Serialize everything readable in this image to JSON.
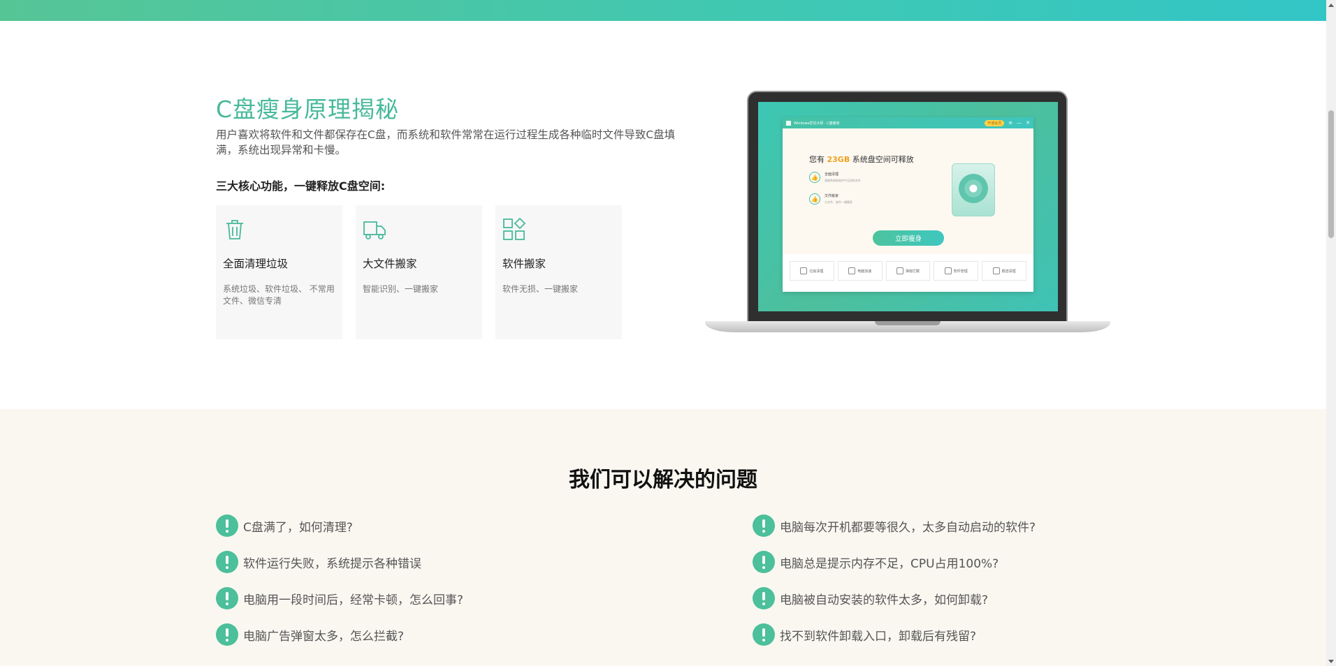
{
  "section_cleanup": {
    "title": "C盘瘦身原理揭秘",
    "description": "用户喜欢将软件和文件都保存在C盘，而系统和软件常常在运行过程生成各种临时文件导致C盘填满，系统出现异常和卡慢。",
    "subtitle": "三大核心功能，一键释放C盘空间:",
    "features": [
      {
        "icon": "trash-icon",
        "name": "全面清理垃圾",
        "desc": "系统垃圾、软件垃圾、 不常用文件、微信专清"
      },
      {
        "icon": "truck-icon",
        "name": "大文件搬家",
        "desc": "智能识别、一键搬家"
      },
      {
        "icon": "apps-icon",
        "name": "软件搬家",
        "desc": "软件无损、一键搬家"
      }
    ]
  },
  "app_preview": {
    "window_title": "Windows优化大师 · C盘瘦身",
    "vip_badge": "开通会员",
    "headline_prefix": "您有",
    "headline_gb": "23GB",
    "headline_suffix": "系统盘空间可释放",
    "items": [
      {
        "title": "全面清理",
        "sub": "清理系统和软件中无用的文件"
      },
      {
        "title": "文件搬家",
        "sub": "大文件、软件一键搬家"
      }
    ],
    "button": "立即瘦身",
    "tools": [
      "垃圾清理",
      "电脑加速",
      "弹窗拦截",
      "软件管理",
      "痕迹清理"
    ]
  },
  "section_problems": {
    "title": "我们可以解决的问题",
    "left": [
      "C盘满了，如何清理?",
      "软件运行失败，系统提示各种错误",
      "电脑用一段时间后，经常卡顿，怎么回事?",
      "电脑广告弹窗太多，怎么拦截?"
    ],
    "right": [
      "电脑每次开机都要等很久，太多自动启动的软件?",
      "电脑总是提示内存不足，CPU占用100%?",
      "电脑被自动安装的软件太多，如何卸载?",
      "找不到软件卸载入口，卸载后有残留?"
    ]
  },
  "colors": {
    "accent": "#47b99a",
    "band_start": "#56c596",
    "band_end": "#33c6c6",
    "problems_bg": "#faf7f1",
    "highlight": "#f0a020"
  }
}
